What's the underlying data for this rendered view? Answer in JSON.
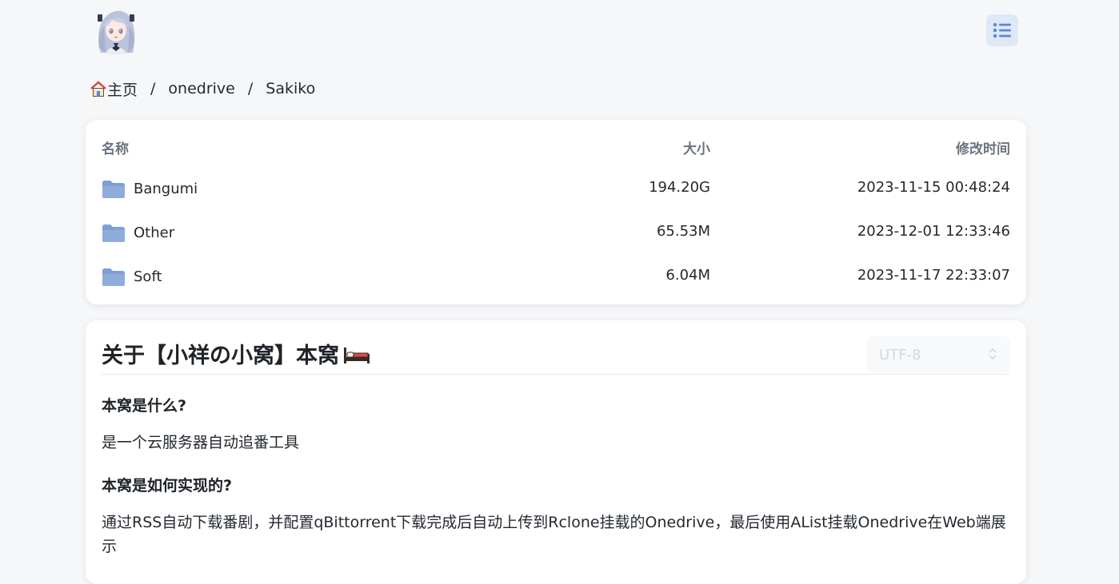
{
  "header": {
    "avatar_icon": "anime-girl-avatar",
    "menu_icon": "list-icon",
    "accent": "#dfe8f6"
  },
  "breadcrumb": {
    "home_icon": "house-icon",
    "home_label": "主页",
    "separator": "/",
    "items": [
      "onedrive",
      "Sakiko"
    ]
  },
  "files": {
    "columns": {
      "name": "名称",
      "size": "大小",
      "modified": "修改时间"
    },
    "rows": [
      {
        "name": "Bangumi",
        "size": "194.20G",
        "modified": "2023-11-15 00:48:24",
        "icon": "folder-icon"
      },
      {
        "name": "Other",
        "size": "65.53M",
        "modified": "2023-12-01 12:33:46",
        "icon": "folder-icon"
      },
      {
        "name": "Soft",
        "size": "6.04M",
        "modified": "2023-11-17 22:33:07",
        "icon": "folder-icon"
      }
    ],
    "folder_color": "#7f9fd3"
  },
  "readme": {
    "title": "关于【小祥の小窝】本窝",
    "title_emoji": "bed-icon",
    "encoding": "UTF-8",
    "sections": [
      {
        "question": "本窝是什么?",
        "answer": "是一个云服务器自动追番工具"
      },
      {
        "question": "本窝是如何实现的?",
        "answer": "通过RSS自动下载番剧，并配置qBittorrent下载完成后自动上传到Rclone挂载的Onedrive，最后使用AList挂载Onedrive在Web端展示"
      }
    ]
  }
}
